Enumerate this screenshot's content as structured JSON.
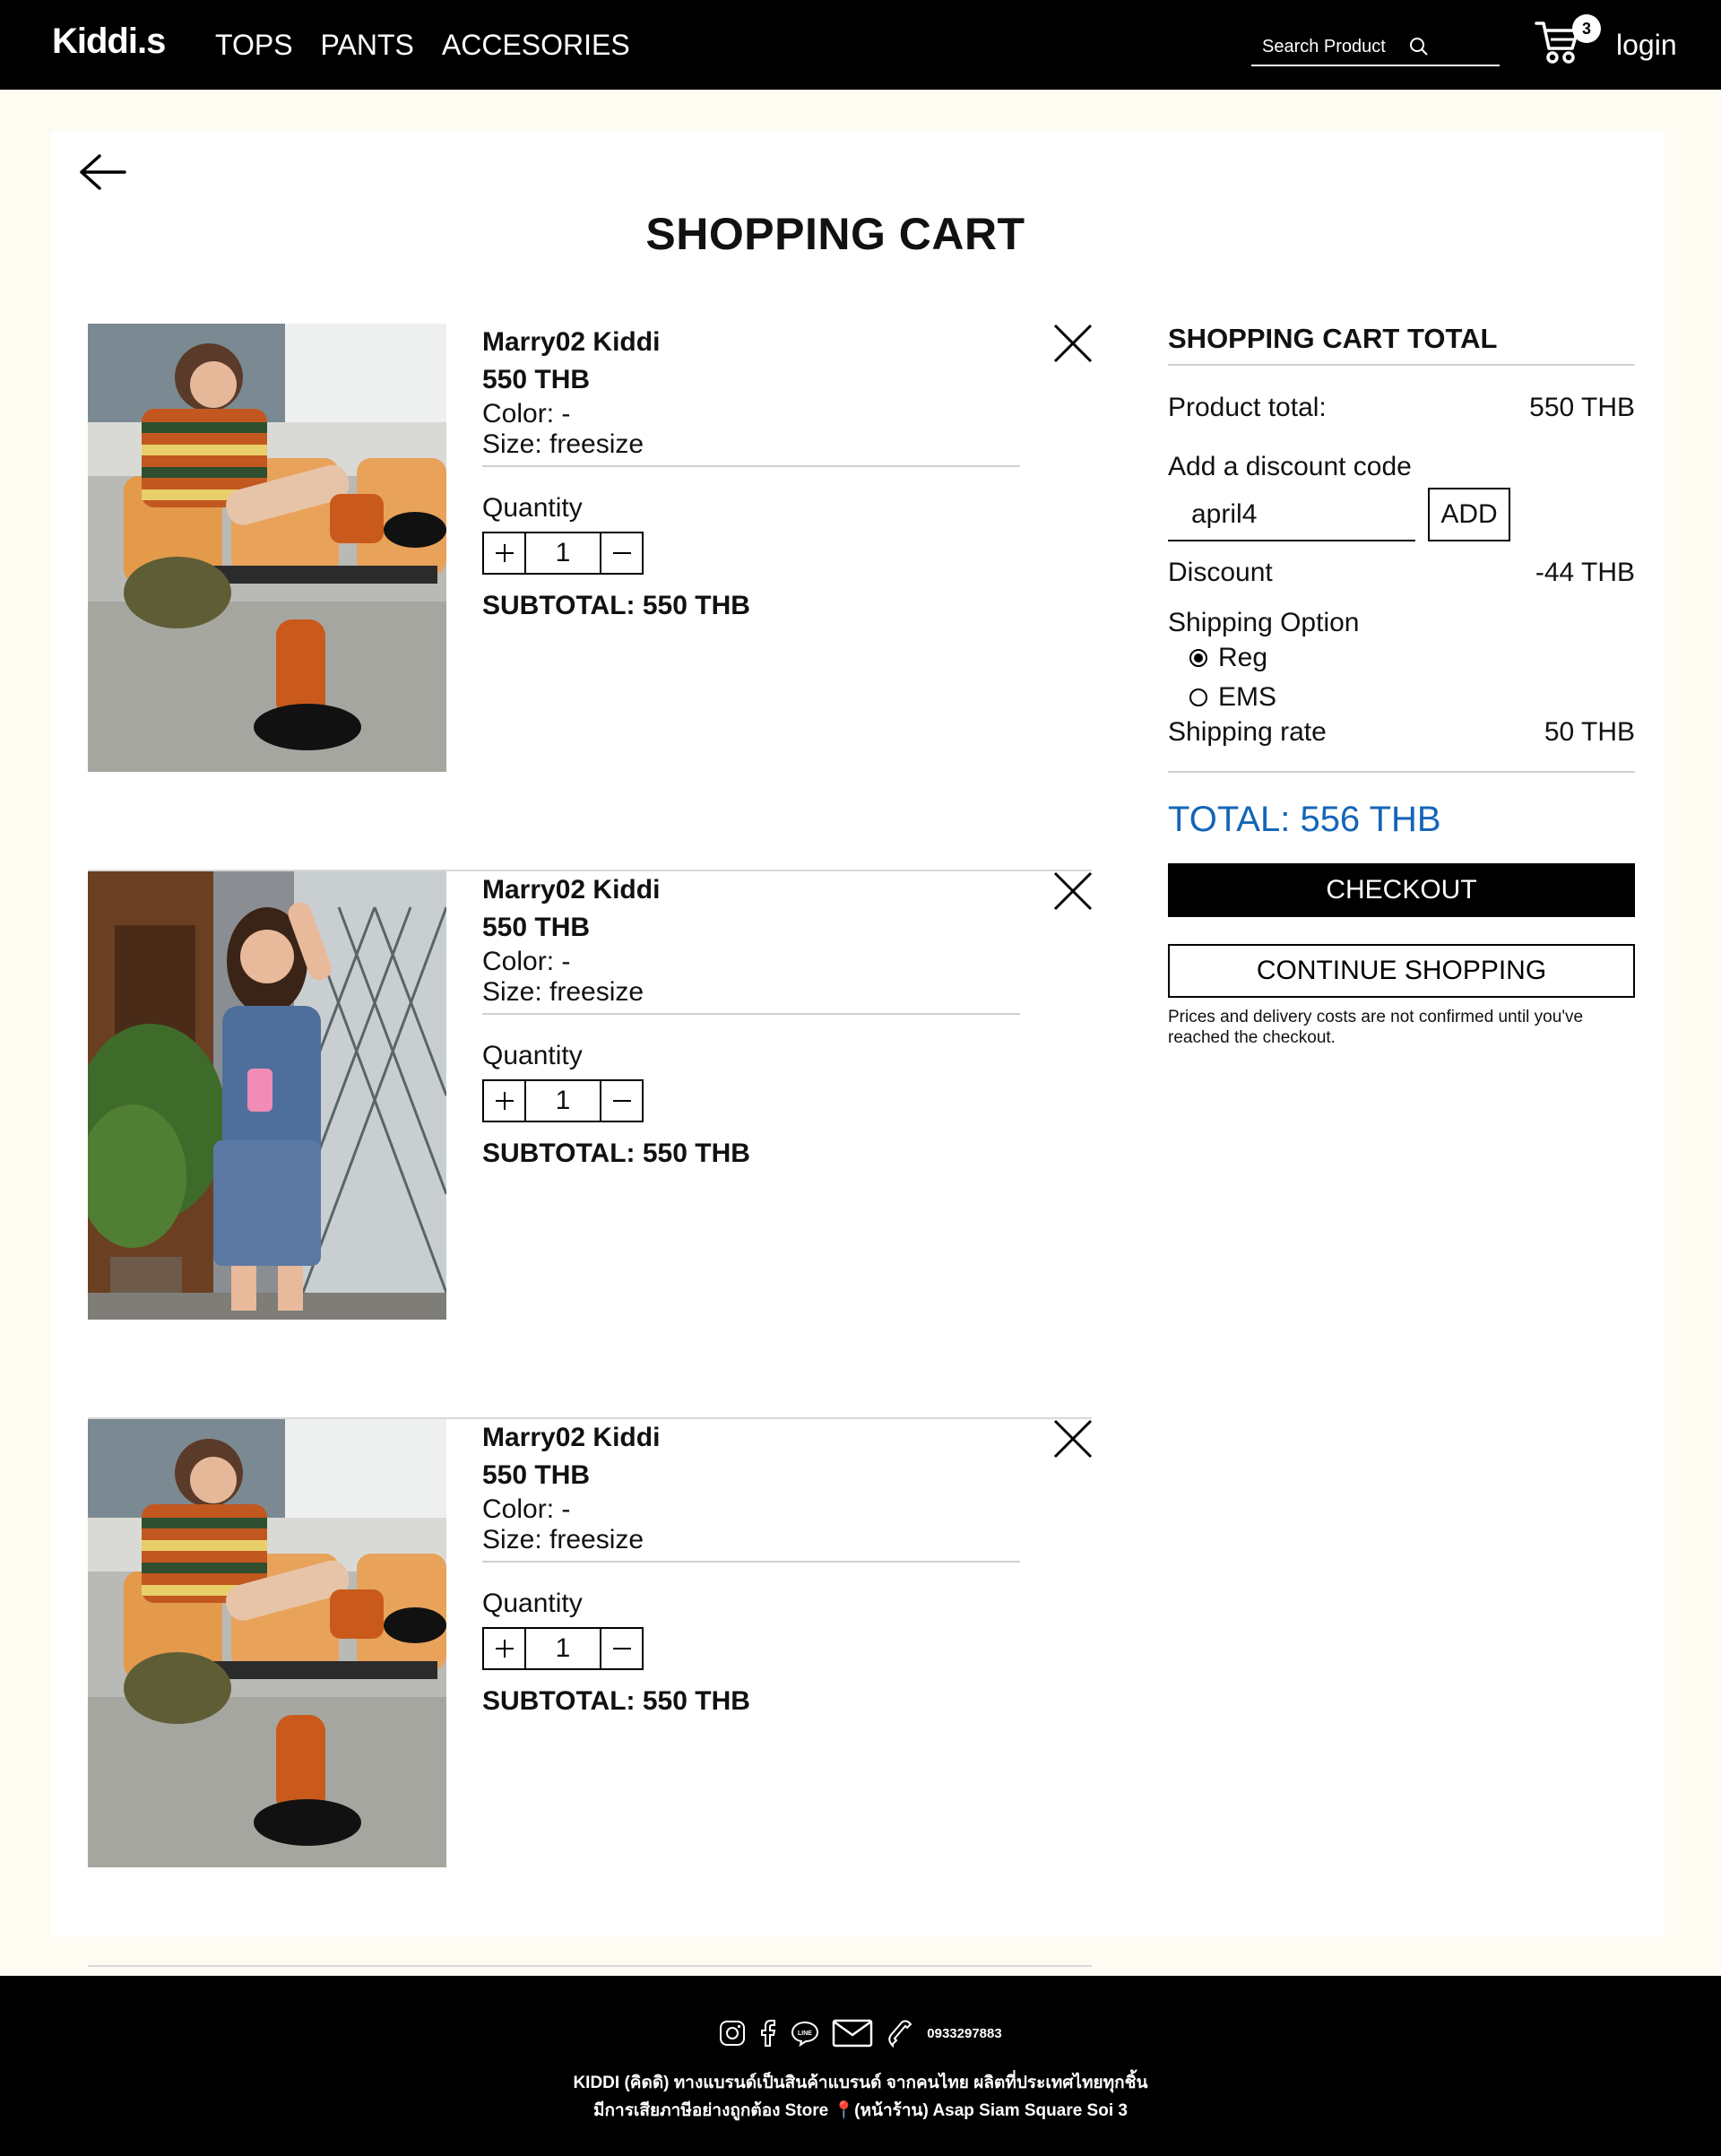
{
  "header": {
    "logo": "Kiddi.s",
    "nav": [
      "TOPS",
      "PANTS",
      "ACCESORIES"
    ],
    "search_placeholder": "Search Product",
    "cart_count": "3",
    "login": "login"
  },
  "page": {
    "title": "SHOPPING CART"
  },
  "cart_items": [
    {
      "name": "Marry02 Kiddi",
      "price": "550 THB",
      "color": "Color: -",
      "size": "Size: freesize",
      "quantity_label": "Quantity",
      "quantity": "1",
      "subtotal": "SUBTOTAL: 550 THB",
      "photo": "girl-striped-cardigan-orange-socks"
    },
    {
      "name": "Marry02 Kiddi",
      "price": "550 THB",
      "color": "Color: -",
      "size": "Size: freesize",
      "quantity_label": "Quantity",
      "quantity": "1",
      "subtotal": "SUBTOTAL: 550 THB",
      "photo": "girl-blue-striped-shirt-shorts"
    },
    {
      "name": "Marry02 Kiddi",
      "price": "550 THB",
      "color": "Color: -",
      "size": "Size: freesize",
      "quantity_label": "Quantity",
      "quantity": "1",
      "subtotal": "SUBTOTAL: 550 THB",
      "photo": "girl-striped-cardigan-orange-socks"
    }
  ],
  "summary": {
    "title": "SHOPPING CART TOTAL",
    "product_total_label": "Product total:",
    "product_total": "550 THB",
    "discount_code_label": "Add a discount code",
    "discount_code_value": "april4",
    "add_label": "ADD",
    "discount_label": "Discount",
    "discount": "-44 THB",
    "shipping_option_label": "Shipping Option",
    "shipping_options": [
      {
        "label": "Reg",
        "selected": true
      },
      {
        "label": "EMS",
        "selected": false
      }
    ],
    "shipping_rate_label": "Shipping rate",
    "shipping_rate": "50 THB",
    "total": "TOTAL: 556 THB",
    "checkout_label": "CHECKOUT",
    "continue_label": "CONTINUE SHOPPING",
    "note": "Prices and delivery costs are not confirmed until you've reached the checkout."
  },
  "footer": {
    "phone": "0933297883",
    "line1": "KIDDI (คิดดิ) ทางแบรนด์เป็นสินค้าแบรนด์ จากคนไทย ผลิตที่ประเทศไทยทุกชิ้น",
    "line2": "มีการเสียภาษีอย่างถูกต้อง Store 📍(หน้าร้าน) Asap Siam Square Soi 3"
  },
  "colors": {
    "header_bg": "#000000",
    "page_bg": "#fdfbf2",
    "total_blue": "#1565b8",
    "footer_bg": "#000000"
  }
}
